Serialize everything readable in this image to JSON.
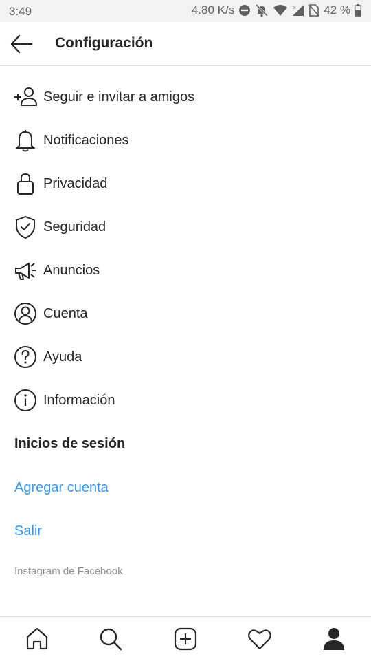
{
  "status_bar": {
    "time": "3:49",
    "speed": "4.80 K/s",
    "battery": "42 %",
    "icons": [
      "do-not-disturb-icon",
      "notifications-off-icon",
      "wifi-icon",
      "signal-icon",
      "no-sim-icon",
      "battery-icon"
    ]
  },
  "header": {
    "back_icon": "arrow-left-icon",
    "title": "Configuración"
  },
  "menu": {
    "items": [
      {
        "label": "Seguir e invitar a amigos",
        "icon": "add-user-icon"
      },
      {
        "label": "Notificaciones",
        "icon": "bell-icon"
      },
      {
        "label": "Privacidad",
        "icon": "lock-icon"
      },
      {
        "label": "Seguridad",
        "icon": "shield-icon"
      },
      {
        "label": "Anuncios",
        "icon": "megaphone-icon"
      },
      {
        "label": "Cuenta",
        "icon": "account-icon"
      },
      {
        "label": "Ayuda",
        "icon": "help-icon"
      },
      {
        "label": "Información",
        "icon": "info-icon"
      }
    ]
  },
  "logins": {
    "section_title": "Inicios de sesión",
    "add_account": "Agregar cuenta",
    "logout": "Salir"
  },
  "footer": {
    "text": "Instagram de Facebook"
  },
  "tab_bar": {
    "tabs": [
      "home-icon",
      "search-icon",
      "new-post-icon",
      "activity-heart-icon",
      "profile-icon"
    ],
    "active": "profile-icon"
  },
  "colors": {
    "link": "#3897f0",
    "text": "#262626",
    "muted": "#8e8e8e",
    "status_bar": "#f2f2f2"
  }
}
